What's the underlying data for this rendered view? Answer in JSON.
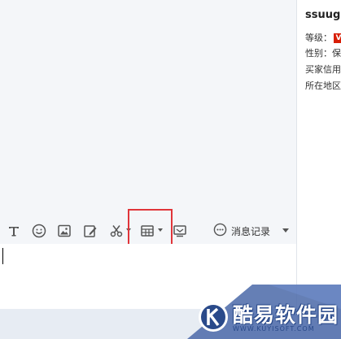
{
  "toolbar": {
    "items": [
      {
        "name": "font",
        "icon": "text-format-icon"
      },
      {
        "name": "emoji",
        "icon": "smiley-icon"
      },
      {
        "name": "image",
        "icon": "image-icon"
      },
      {
        "name": "edit",
        "icon": "pencil-edit-icon"
      },
      {
        "name": "screenshot",
        "icon": "scissors-icon"
      },
      {
        "name": "calculator",
        "icon": "calculator-icon"
      },
      {
        "name": "transfer",
        "icon": "monitor-icon"
      }
    ],
    "history_label": "消息记录",
    "history_icon": "speech-bubble-icon"
  },
  "profile": {
    "name": "ssuug",
    "level_label": "等级：",
    "level_badge": "V",
    "gender_label": "性别：保",
    "credit_label": "买家信用",
    "region_label": "所在地区"
  },
  "watermark": {
    "text": "酷易软件园",
    "url": "WWW.KUYISOFT.COM",
    "logo_letter": "K"
  },
  "colors": {
    "highlight": "#e0353a",
    "badge": "#d81e06",
    "watermark_blue": "#2a4a8a"
  }
}
